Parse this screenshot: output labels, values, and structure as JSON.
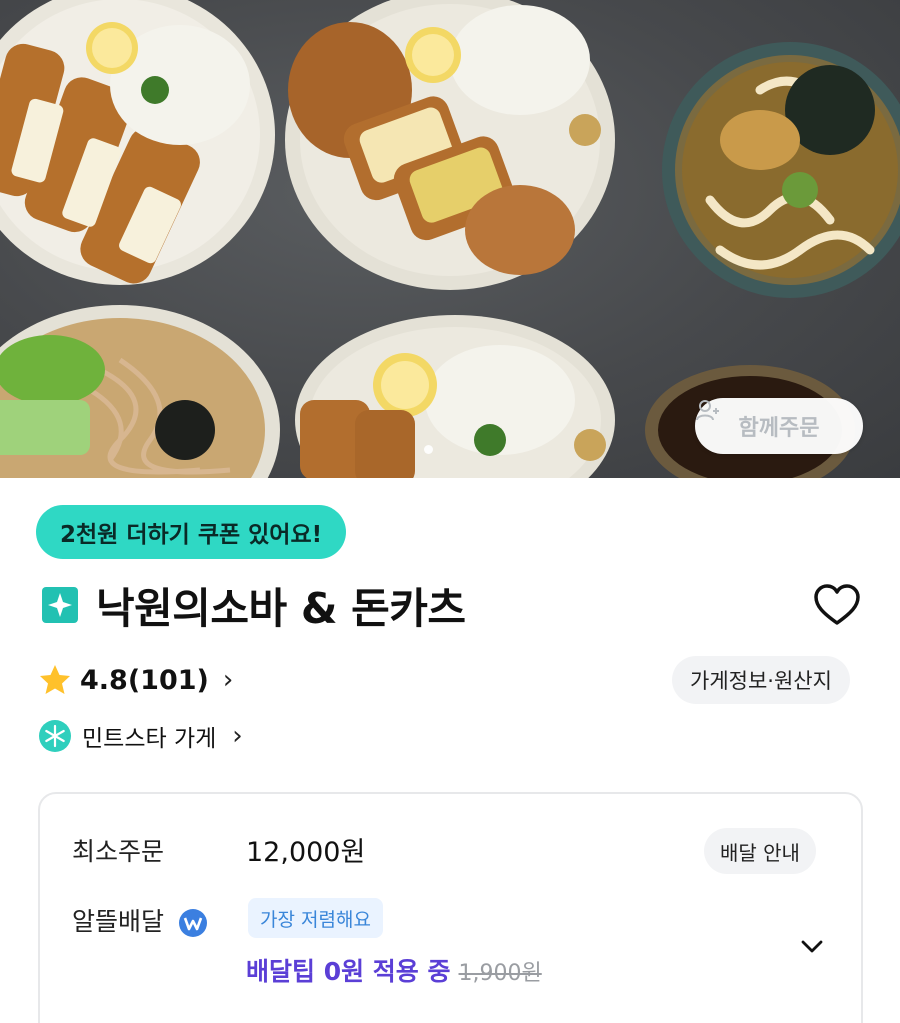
{
  "hero": {
    "together_order_label": "함께주문",
    "together_icon": "add-person-icon"
  },
  "store": {
    "coupon_text": "2천원 더하기 쿠폰 있어요!",
    "name": "낙원의소바 & 돈카츠",
    "badge_icon": "sparkle-badge-icon",
    "rating": "4.8(101)",
    "info_chip": "가게정보·원산지",
    "minsta_label": "민트스타 가게",
    "accent_color": "#2fd8c4"
  },
  "delivery": {
    "min_order_label": "최소주문",
    "min_order_value": "12,000원",
    "guide_chip": "배달 안내",
    "saver_label": "알뜰배달",
    "cheapest_tag": "가장 저렴해요",
    "tip_text": "배달팁 0원 적용 중",
    "tip_old": "1,900원",
    "tip_color": "#5b3fd6"
  }
}
